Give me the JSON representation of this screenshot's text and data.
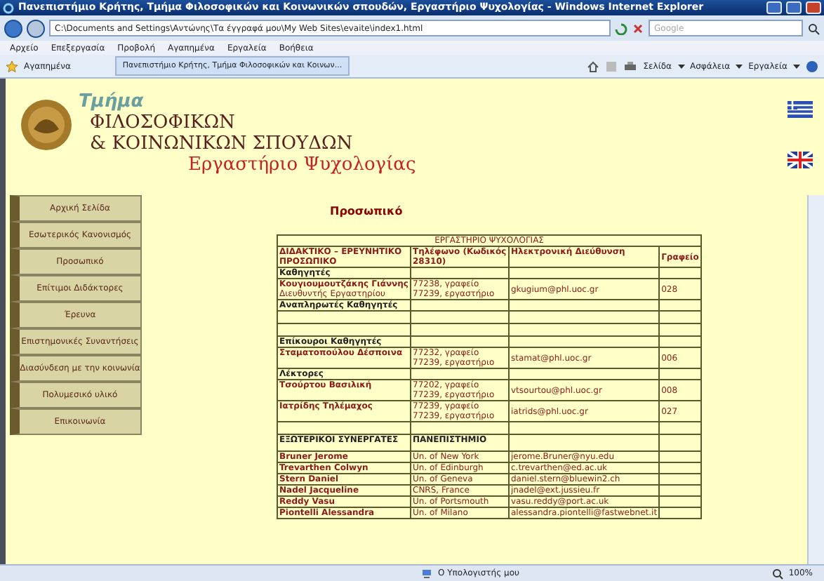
{
  "window": {
    "title": "Πανεπιστήμιο Κρήτης, Τμήμα Φιλοσοφικών και Κοινωνικών σπουδών, Εργαστήριο Ψυχολογίας - Windows Internet Explorer"
  },
  "address_bar": {
    "url": "C:\\Documents and Settings\\Αντώνης\\Τα έγγραφά μου\\My Web Sites\\evaite\\index1.html"
  },
  "search": {
    "placeholder": "Google"
  },
  "menu_bar": [
    "Αρχείο",
    "Επεξεργασία",
    "Προβολή",
    "Αγαπημένα",
    "Εργαλεία",
    "Βοήθεια"
  ],
  "favorites_bar": {
    "favorites": "Αγαπημένα",
    "tab": {
      "label": "Πανεπιστήμιο Κρήτης, Τμήμα Φιλοσοφικών και Κοινων...",
      "selected": true
    },
    "tools": [
      "Σελίδα",
      "Ασφάλεια",
      "Εργαλεία"
    ]
  },
  "page": {
    "header": {
      "watermark": "Τμήμα",
      "line_1": "ΦΙΛΟΣΟΦΙΚΩΝ",
      "line_2": "& ΚΟΙΝΩΝΙΚΩΝ ΣΠΟΥΔΩΝ",
      "subtitle": "Εργαστήριο Ψυχολογίας"
    },
    "sidebar": {
      "items": [
        "Αρχική Σελίδα",
        "Εσωτερικός Κανονισμός",
        "Προσωπικό",
        "Επίτιμοι Διδάκτορες",
        "Έρευνα",
        "Επιστημονικές Συναντήσεις",
        "Διασύνδεση με την κοινωνία",
        "Πολυμεσικό υλικό",
        "Επικοινωνία"
      ]
    },
    "heading": "Προσωπικό",
    "table": {
      "caption": "ΕΡΓΑΣΤΗΡΙΟ ΨΥΧΟΛΟΓΙΑΣ",
      "columns": [
        "ΔΙΔΑΚΤΙΚΟ – ΕΡΕΥΝΗΤΙΚΟ ΠΡΟΣΩΠΙΚΟ",
        "Τηλέφωνο (Κωδικός 28310)",
        "Ηλεκτρονική Διεύθυνση",
        "Γραφείο"
      ],
      "rows": [
        {
          "kind": "section",
          "label": "Καθηγητές"
        },
        {
          "kind": "person",
          "name": "Κουγιουμουτζάκης Γιάννης",
          "role": "Διευθυντής Εργαστηρίου",
          "phone": [
            "77238, γραφείο",
            "77239, εργαστήριο"
          ],
          "email": "gkugium@phl.uoc.gr",
          "office": "028"
        },
        {
          "kind": "section",
          "label": "Αναπληρωτές Καθηγητές"
        },
        {
          "kind": "empty"
        },
        {
          "kind": "empty"
        },
        {
          "kind": "section",
          "label": "Επίκουροι Καθηγητές"
        },
        {
          "kind": "person",
          "name": "Σταματοπούλου Δέσποινα",
          "phone": [
            "77232, γραφείο",
            "77239, εργαστήριο"
          ],
          "email": "stamat@phl.uoc.gr",
          "office": "006"
        },
        {
          "kind": "section",
          "label": "Λέκτορες"
        },
        {
          "kind": "person",
          "name": "Τσούρτου Βασιλική",
          "phone": [
            "77202, γραφείο",
            "77239, εργαστήριο"
          ],
          "email": "vtsourtou@phl.uoc.gr",
          "office": "008"
        },
        {
          "kind": "person",
          "name": "Ιατρίδης Τηλέμαχος",
          "phone": [
            "77239, γραφείο",
            "77239, εργαστήριο"
          ],
          "email": "iatrids@phl.uoc.gr",
          "office": "027"
        },
        {
          "kind": "empty"
        },
        {
          "kind": "subheader",
          "cells": [
            "ΕΞΩΤΕΡΙΚΟΙ ΣΥΝΕΡΓΑΤΕΣ",
            "ΠΑΝΕΠΙΣΤΗΜΙΟ"
          ]
        },
        {
          "kind": "external",
          "name": "Bruner Jerome",
          "university": "Un. of New York",
          "email": "jerome.Bruner@nyu.edu"
        },
        {
          "kind": "external",
          "name": "Trevarthen Colwyn",
          "university": "Un. of Edinburgh",
          "email": "c.trevarthen@ed.ac.uk"
        },
        {
          "kind": "external",
          "name": "Stern Daniel",
          "university": "Un. of Geneva",
          "email": "daniel.stern@bluewin2.ch"
        },
        {
          "kind": "external",
          "name": "Nadel Jacqueline",
          "university": "CNRS, France",
          "email": "jnadel@ext.jussieu.fr"
        },
        {
          "kind": "external",
          "name": "Reddy Vasu",
          "university": "Un. of Portsmouth",
          "email": "vasu.reddy@port.ac.uk"
        },
        {
          "kind": "external",
          "name": "Piontelli Alessandra",
          "university": "Un. of Milano",
          "email": "alessandra.piontelli@fastwebnet.it"
        }
      ]
    }
  },
  "status_bar": {
    "zone": "Ο Υπολογιστής μου",
    "zoom": "100%"
  }
}
